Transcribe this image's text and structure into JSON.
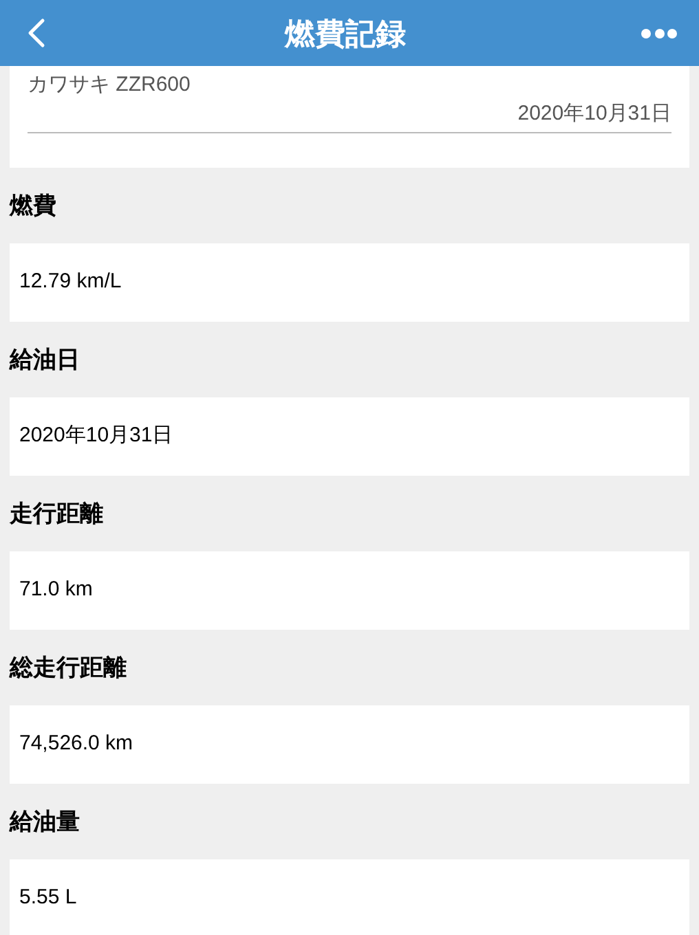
{
  "header": {
    "title": "燃費記録"
  },
  "vehicle": {
    "name": "カワサキ ZZR600",
    "date": "2020年10月31日"
  },
  "fields": [
    {
      "label": "燃費",
      "value": "12.79 km/L"
    },
    {
      "label": "給油日",
      "value": "2020年10月31日"
    },
    {
      "label": "走行距離",
      "value": "71.0 km"
    },
    {
      "label": "総走行距離",
      "value": "74,526.0 km"
    },
    {
      "label": "給油量",
      "value": "5.55 L"
    }
  ]
}
